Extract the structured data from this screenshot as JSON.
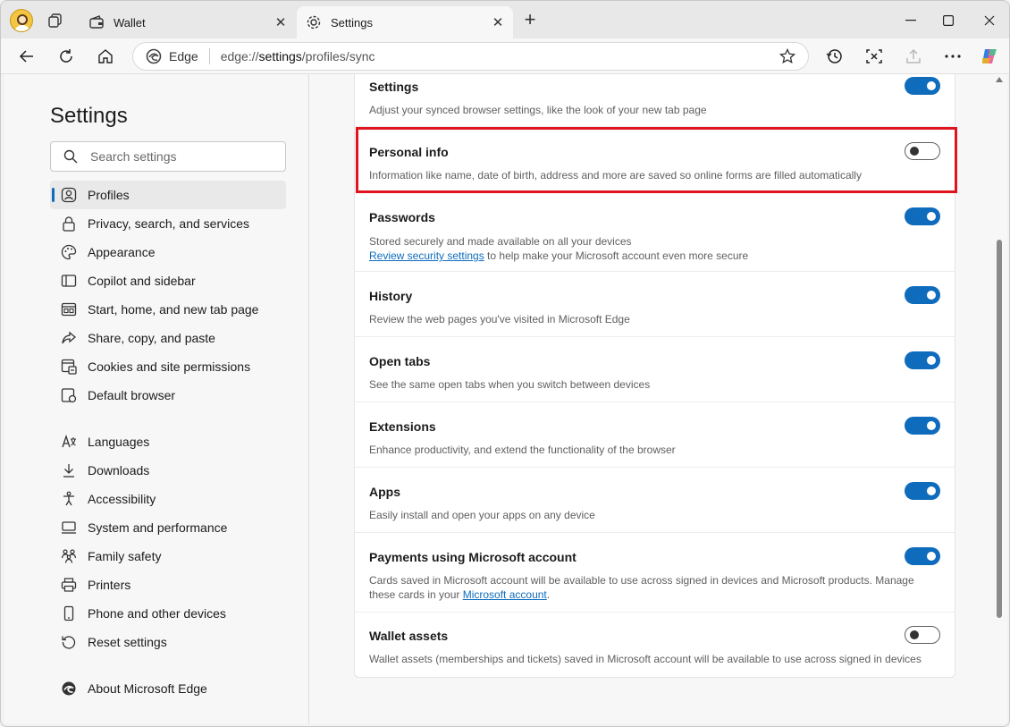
{
  "browser": {
    "tabs": [
      {
        "label": "Wallet",
        "icon": "wallet-icon",
        "active": false
      },
      {
        "label": "Settings",
        "icon": "gear-icon",
        "active": true
      }
    ],
    "address": {
      "site_label": "Edge",
      "url_prefix": "edge://",
      "url_bold": "settings",
      "url_suffix": "/profiles/sync"
    }
  },
  "sidebar": {
    "title": "Settings",
    "search_placeholder": "Search settings",
    "items": [
      {
        "label": "Profiles",
        "icon": "profile-icon",
        "selected": true
      },
      {
        "label": "Privacy, search, and services",
        "icon": "lock-icon"
      },
      {
        "label": "Appearance",
        "icon": "palette-icon"
      },
      {
        "label": "Copilot and sidebar",
        "icon": "sidebar-icon"
      },
      {
        "label": "Start, home, and new tab page",
        "icon": "home-page-icon"
      },
      {
        "label": "Share, copy, and paste",
        "icon": "share-icon"
      },
      {
        "label": "Cookies and site permissions",
        "icon": "cookie-icon"
      },
      {
        "label": "Default browser",
        "icon": "browser-icon"
      },
      {
        "label": "Languages",
        "icon": "language-icon"
      },
      {
        "label": "Downloads",
        "icon": "download-icon"
      },
      {
        "label": "Accessibility",
        "icon": "accessibility-icon"
      },
      {
        "label": "System and performance",
        "icon": "system-icon"
      },
      {
        "label": "Family safety",
        "icon": "family-icon"
      },
      {
        "label": "Printers",
        "icon": "printer-icon"
      },
      {
        "label": "Phone and other devices",
        "icon": "phone-icon"
      },
      {
        "label": "Reset settings",
        "icon": "reset-icon"
      },
      {
        "label": "About Microsoft Edge",
        "icon": "edge-logo-icon"
      }
    ]
  },
  "sync": {
    "rows": [
      {
        "title": "Settings",
        "desc": "Adjust your synced browser settings, like the look of your new tab page",
        "on": true
      },
      {
        "title": "Personal info",
        "desc": "Information like name, date of birth, address and more are saved so online forms are filled automatically",
        "on": false
      },
      {
        "title": "Passwords",
        "desc": "Stored securely and made available on all your devices",
        "link": "Review security settings",
        "desc_after": " to help make your Microsoft account even more secure",
        "on": true
      },
      {
        "title": "History",
        "desc": "Review the web pages you've visited in Microsoft Edge",
        "on": true
      },
      {
        "title": "Open tabs",
        "desc": "See the same open tabs when you switch between devices",
        "on": true
      },
      {
        "title": "Extensions",
        "desc": "Enhance productivity, and extend the functionality of the browser",
        "on": true
      },
      {
        "title": "Apps",
        "desc": "Easily install and open your apps on any device",
        "on": true
      },
      {
        "title": "Payments using Microsoft account",
        "desc": "Cards saved in Microsoft account will be available to use across signed in devices and Microsoft products. Manage these cards in your ",
        "link": "Microsoft account",
        "desc_after": ".",
        "on": true
      },
      {
        "title": "Wallet assets",
        "desc": "Wallet assets (memberships and tickets) saved in Microsoft account will be available to use across signed in devices",
        "on": false
      }
    ]
  },
  "colors": {
    "accent": "#0f6cbd",
    "highlight": "#e0141e"
  }
}
